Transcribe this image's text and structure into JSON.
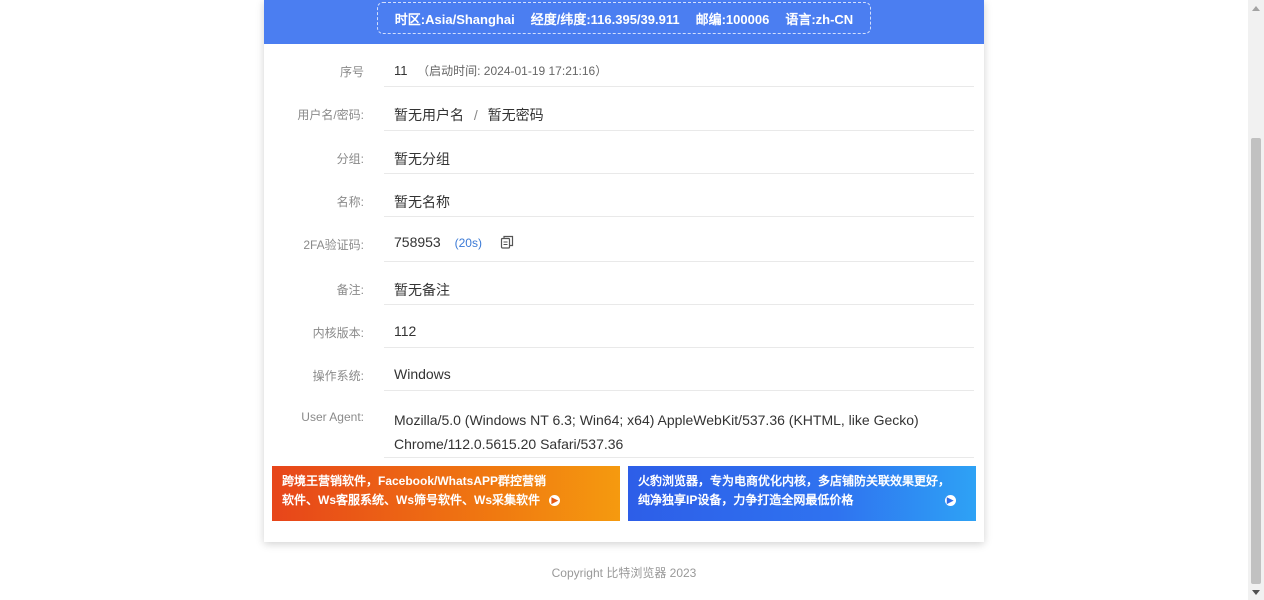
{
  "header": {
    "timezone": "时区:Asia/Shanghai",
    "coords": "经度/纬度:116.395/39.911",
    "postal": "邮编:100006",
    "language": "语言:zh-CN"
  },
  "rows": {
    "seq": {
      "label": "序号",
      "value": "11",
      "note": "（启动时间: 2024-01-19 17:21:16）"
    },
    "account": {
      "label": "用户名/密码:",
      "username": "暂无用户名",
      "sep": "/",
      "password": "暂无密码"
    },
    "group": {
      "label": "分组:",
      "value": "暂无分组"
    },
    "name": {
      "label": "名称:",
      "value": "暂无名称"
    },
    "twofa": {
      "label": "2FA验证码:",
      "value": "758953",
      "countdown": "(20s)"
    },
    "remark": {
      "label": "备注:",
      "value": "暂无备注"
    },
    "kernel": {
      "label": "内核版本:",
      "value": "112"
    },
    "os": {
      "label": "操作系统:",
      "value": "Windows"
    },
    "ua": {
      "label": "User Agent:",
      "line1": "Mozilla/5.0 (Windows NT 6.3; Win64; x64) AppleWebKit/537.36 (KHTML, like Gecko)",
      "line2": "Chrome/112.0.5615.20 Safari/537.36"
    }
  },
  "banners": {
    "left": {
      "line1": "跨境王营销软件，Facebook/WhatsAPP群控营销",
      "line2": "软件、Ws客服系统、Ws筛号软件、Ws采集软件"
    },
    "right": {
      "line1": "火豹浏览器，专为电商优化内核，多店铺防关联效果更好，",
      "line2": "纯净独享IP设备，力争打造全网最低价格"
    }
  },
  "footer": {
    "copyright": "Copyright 比特浏览器 2023"
  },
  "colors": {
    "header_blue": "#4b7ef1",
    "countdown_blue": "#3a79d6"
  },
  "icons": {
    "copy": "copy-icon",
    "banner_arrow": "arrow-right-circle-icon"
  }
}
